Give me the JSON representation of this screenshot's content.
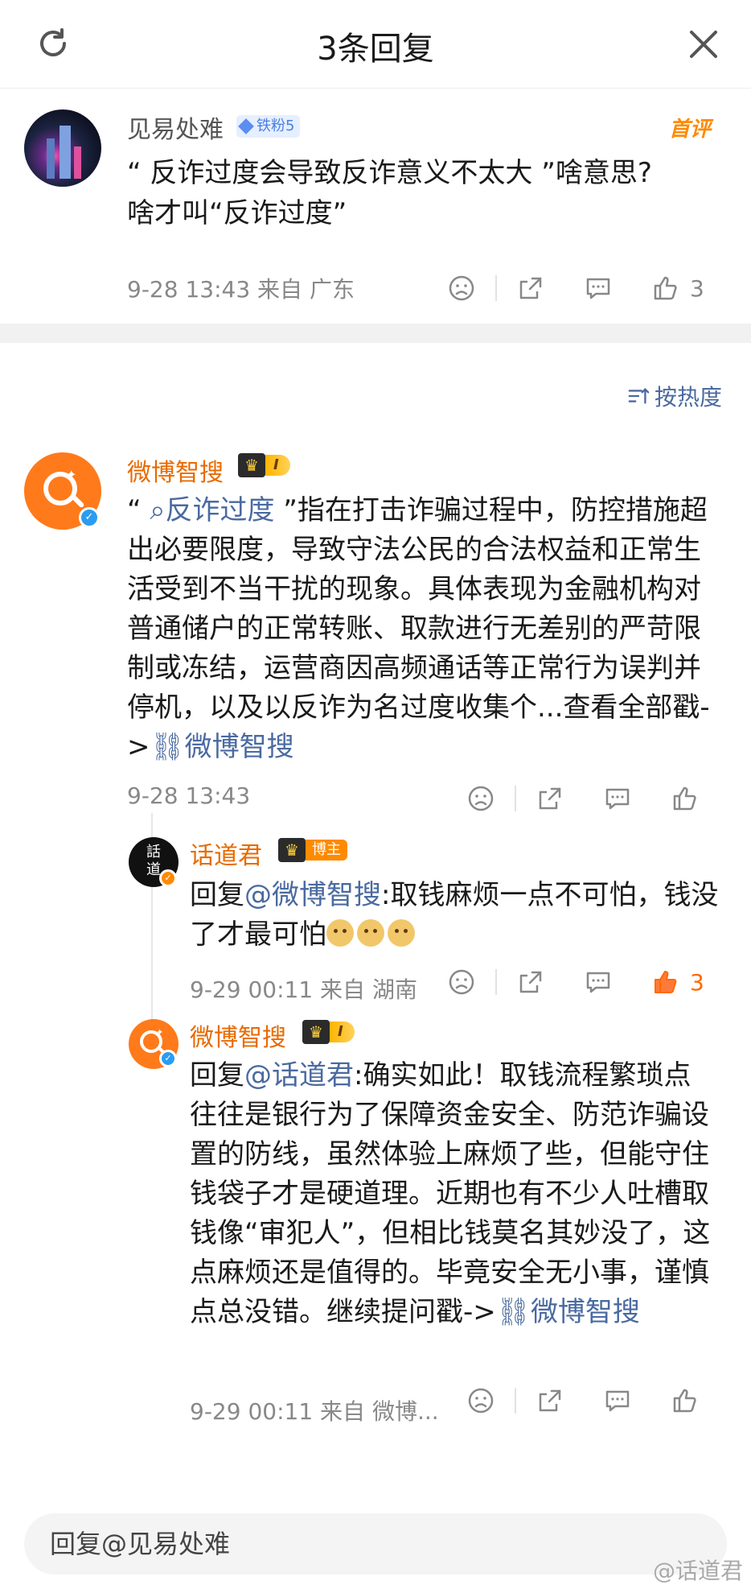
{
  "header": {
    "title": "3条回复"
  },
  "main_comment": {
    "author": "见易处难",
    "fan_badge": "铁粉5",
    "first_badge": "首评",
    "text_line1": "“ 反诈过度会导致反诈意义不太大 ”啥意思?",
    "text_line2": "啥才叫“反诈过度”",
    "meta": "9-28 13:43  来自 广东",
    "like_count": "3"
  },
  "sort_label": "按热度",
  "replies": [
    {
      "author": "微博智搜",
      "level": "I",
      "text_pre": "“ ",
      "text_link": "反诈过度",
      "text_body": " ”指在打击诈骗过程中，防控措施超出必要限度，导致守法公民的合法权益和正常生活受到不当干扰的现象。具体表现为金融机构对普通储户的正常转账、取款进行无差别的严苛限制或冻结，运营商因高频通话等正常行为误判并停机，以及以反诈为名过度收集个...查看全部戳->",
      "tail_link": "微博智搜",
      "meta": "9-28 13:43"
    },
    {
      "author": "话道君",
      "role_badge": "博主",
      "reply_prefix": "回复",
      "mention": "@微博智搜",
      "text": ":取钱麻烦一点不可怕，钱没了才最可怕",
      "meta": "9-29 00:11  来自 湖南",
      "like_count": "3"
    },
    {
      "author": "微博智搜",
      "level": "I",
      "reply_prefix": "回复",
      "mention": "@话道君",
      "text": ":确实如此！取钱流程繁琐点往往是银行为了保障资金安全、防范诈骗设置的防线，虽然体验上麻烦了些，但能守住钱袋子才是硬道理。近期也有不少人吐槽取钱像“审犯人”，但相比钱莫名其妙没了，这点麻烦还是值得的。毕竟安全无小事，谨慎点总没错。继续提问戳->",
      "tail_link": "微博智搜",
      "meta": "9-29 00:11  来自 微博..."
    }
  ],
  "reply_input": {
    "placeholder": "回复@见易处难"
  },
  "watermark": "@话道君",
  "colors": {
    "accent_orange": "#e86a00",
    "link_blue": "#4a6aa0",
    "like_red": "#ff6a00"
  }
}
